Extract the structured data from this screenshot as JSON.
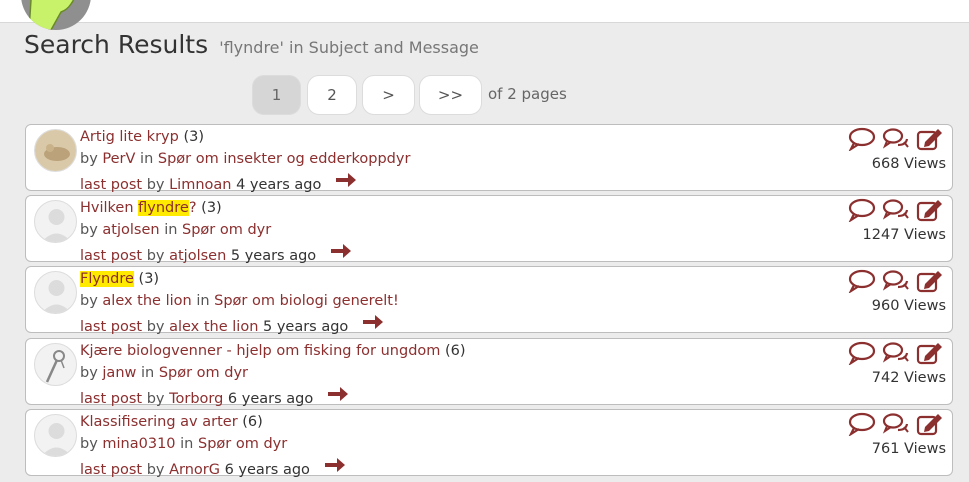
{
  "header": {
    "title": "Search Results",
    "subtitle": "'flyndre' in Subject and Message"
  },
  "pagination": {
    "pages": [
      "1",
      "2",
      ">",
      ">>"
    ],
    "current": "1",
    "total_text": "of 2 pages"
  },
  "labels": {
    "by": "by",
    "in": "in",
    "last_post": "last post"
  },
  "colors": {
    "link": "#8b2f2f",
    "highlight": "#ffea00",
    "icon": "#8b2f2f"
  },
  "topics": [
    {
      "title_before": "Artig lite kryp",
      "title_highlight": "",
      "title_after": "",
      "count": "(3)",
      "author": "PerV",
      "forum": "Spør om insekter og edderkoppdyr",
      "last_poster": "Limnoan",
      "age": "4 years ago",
      "views": "668 Views",
      "avatar": "photo-avatar"
    },
    {
      "title_before": "Hvilken ",
      "title_highlight": "flyndre",
      "title_after": "?",
      "count": "(3)",
      "author": "atjolsen",
      "forum": "Spør om dyr",
      "last_poster": "atjolsen",
      "age": "5 years ago",
      "views": "1247 Views",
      "avatar": "default-avatar"
    },
    {
      "title_before": "",
      "title_highlight": "Flyndre",
      "title_after": "",
      "count": "(3)",
      "author": "alex the lion",
      "forum": "Spør om biologi generelt!",
      "last_poster": "alex the lion",
      "age": "5 years ago",
      "views": "960 Views",
      "avatar": "default-avatar"
    },
    {
      "title_before": "Kjære biologvenner - hjelp om fisking for ungdom",
      "title_highlight": "",
      "title_after": "",
      "count": "(6)",
      "author": "janw",
      "forum": "Spør om dyr",
      "last_poster": "Torborg",
      "age": "6 years ago",
      "views": "742 Views",
      "avatar": "sketch-avatar"
    },
    {
      "title_before": "Klassifisering av arter",
      "title_highlight": "",
      "title_after": "",
      "count": "(6)",
      "author": "mina0310",
      "forum": "Spør om dyr",
      "last_poster": "ArnorG",
      "age": "6 years ago",
      "views": "761 Views",
      "avatar": "default-avatar"
    }
  ]
}
